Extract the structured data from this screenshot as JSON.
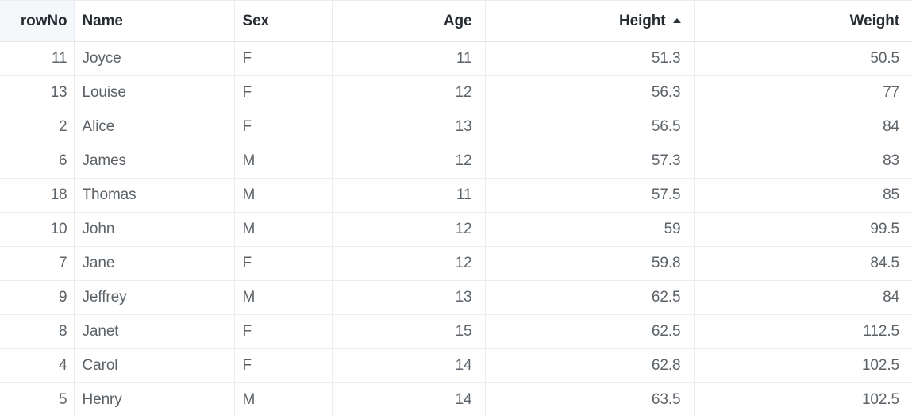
{
  "table": {
    "sort": {
      "column": "Height",
      "direction": "asc",
      "indicator_icon": "sort-ascending-triangle-icon"
    },
    "colors": {
      "row_number_header_background": "#f4f8fb",
      "header_text": "#262c32",
      "body_text": "#5b6268",
      "grid_line": "#ededed",
      "background": "#ffffff"
    },
    "columns": [
      {
        "key": "rowNo",
        "label": "rowNo",
        "align": "right",
        "sorted": false
      },
      {
        "key": "name",
        "label": "Name",
        "align": "left",
        "sorted": false
      },
      {
        "key": "sex",
        "label": "Sex",
        "align": "left",
        "sorted": false
      },
      {
        "key": "age",
        "label": "Age",
        "align": "right",
        "sorted": false
      },
      {
        "key": "height",
        "label": "Height",
        "align": "right",
        "sorted": true
      },
      {
        "key": "weight",
        "label": "Weight",
        "align": "right",
        "sorted": false
      }
    ],
    "rows": [
      {
        "rowNo": "11",
        "name": "Joyce",
        "sex": "F",
        "age": "11",
        "height": "51.3",
        "weight": "50.5"
      },
      {
        "rowNo": "13",
        "name": "Louise",
        "sex": "F",
        "age": "12",
        "height": "56.3",
        "weight": "77"
      },
      {
        "rowNo": "2",
        "name": "Alice",
        "sex": "F",
        "age": "13",
        "height": "56.5",
        "weight": "84"
      },
      {
        "rowNo": "6",
        "name": "James",
        "sex": "M",
        "age": "12",
        "height": "57.3",
        "weight": "83"
      },
      {
        "rowNo": "18",
        "name": "Thomas",
        "sex": "M",
        "age": "11",
        "height": "57.5",
        "weight": "85"
      },
      {
        "rowNo": "10",
        "name": "John",
        "sex": "M",
        "age": "12",
        "height": "59",
        "weight": "99.5"
      },
      {
        "rowNo": "7",
        "name": "Jane",
        "sex": "F",
        "age": "12",
        "height": "59.8",
        "weight": "84.5"
      },
      {
        "rowNo": "9",
        "name": "Jeffrey",
        "sex": "M",
        "age": "13",
        "height": "62.5",
        "weight": "84"
      },
      {
        "rowNo": "8",
        "name": "Janet",
        "sex": "F",
        "age": "15",
        "height": "62.5",
        "weight": "112.5"
      },
      {
        "rowNo": "4",
        "name": "Carol",
        "sex": "F",
        "age": "14",
        "height": "62.8",
        "weight": "102.5"
      },
      {
        "rowNo": "5",
        "name": "Henry",
        "sex": "M",
        "age": "14",
        "height": "63.5",
        "weight": "102.5"
      }
    ]
  }
}
